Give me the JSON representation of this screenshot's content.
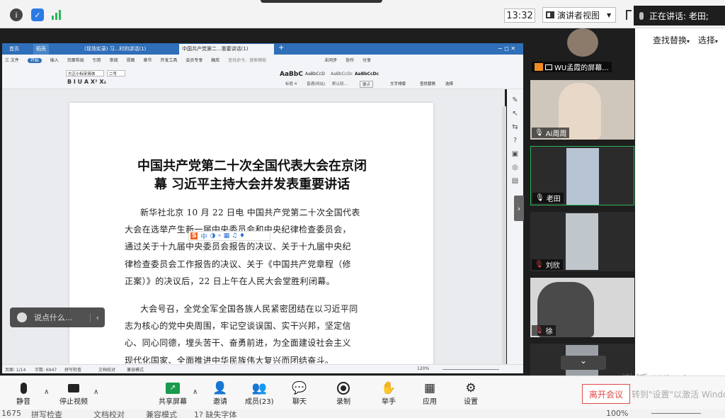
{
  "topbar": {
    "time": "13:32",
    "view_label": "演讲者视图",
    "speaking_label": "正在讲话: 老田;"
  },
  "wps": {
    "tabs": [
      "首页",
      "稻壳",
      "(现场实录) 习...时的讲话(1)",
      "中国共产党第二...重要讲话(1)"
    ],
    "menu": [
      "三 文件",
      "开始",
      "插入",
      "页面布局",
      "引用",
      "审阅",
      "视图",
      "章节",
      "开发工具",
      "会员专享",
      "稿库",
      "查找命令、搜索模板",
      "未同步",
      "协作",
      "分享"
    ],
    "font_name": "方正小标宋简体",
    "font_size": "二号",
    "styles": [
      "AaBbC",
      "AaBbCcD",
      "AaBbCcDc",
      "AaBbCcDc"
    ],
    "style_names": [
      "标题 4",
      "普通(网站)",
      "默认段...",
      "要点"
    ],
    "ribbon_right": [
      "文字排版",
      "查找替换",
      "选择"
    ],
    "status": {
      "page": "页面: 1/14",
      "words": "字数: 6947",
      "spell": "拼写检查",
      "proof": "文档校对",
      "compat": "兼容模式",
      "zoom": "120%"
    }
  },
  "doc": {
    "title_line1": "中国共产党第二十次全国代表大会在京闭",
    "title_line2": "幕  习近平主持大会并发表重要讲话",
    "para1": [
      "新华社北京 10 月 22 日电  中国共产党第二十次全国代表",
      "大会在选举产生新一届中央委员会和中央纪律检查委员会，",
      "通过关于十九届中央委员会报告的决议、关于十九届中央纪",
      "律检查委员会工作报告的决议、关于《中国共产党章程（修",
      "正案）》的决议后，22 日上午在人民大会堂胜利闭幕。"
    ],
    "para2": [
      "大会号召，全党全军全国各族人民紧密团结在以习近平同",
      "志为核心的党中央周围，牢记空谈误国、实干兴邦，坚定信",
      "心、同心同德，埋头苦干、奋勇前进，为全面建设社会主义",
      "现代化国家、全面推进中华民族伟大复兴而团结奋斗。"
    ],
    "ime": "中"
  },
  "comment_placeholder": "说点什么...",
  "participants": [
    {
      "name": "WU孟霞的屏幕..."
    },
    {
      "name": "Ai周周"
    },
    {
      "name": "老田"
    },
    {
      "name": "刘欣"
    },
    {
      "name": "徐"
    }
  ],
  "right_strip": {
    "find": "查找替换",
    "select": "选择"
  },
  "toolbar": {
    "mute": "静音",
    "video": "停止视频",
    "share": "共享屏幕",
    "invite": "邀请",
    "members": "成员(23)",
    "chat": "聊天",
    "record": "录制",
    "raise": "举手",
    "apps": "应用",
    "settings": "设置",
    "leave": "离开会议"
  },
  "watermark": {
    "line1": "激活 Windows",
    "line2": "转到\"设置\"以激活 Windows"
  },
  "footer": {
    "c1": "1675",
    "c2": "拼写检查",
    "c3": "文档校对",
    "c4": "兼容模式",
    "c5": "1? 缺失字体",
    "c6": "100%"
  }
}
